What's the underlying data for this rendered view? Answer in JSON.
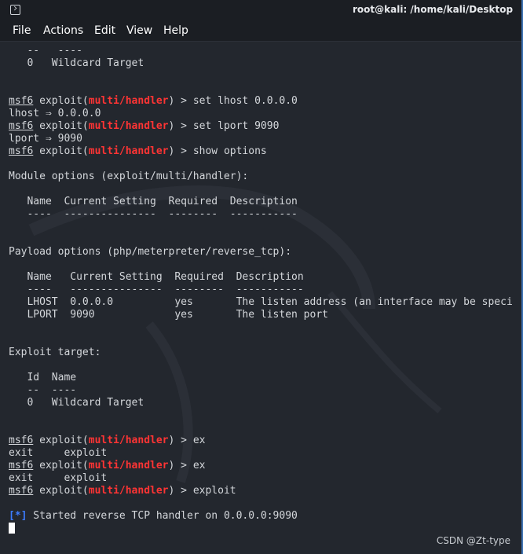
{
  "window": {
    "title": "root@kali: /home/kali/Desktop"
  },
  "menu": [
    "File",
    "Actions",
    "Edit",
    "View",
    "Help"
  ],
  "icons": {
    "app": "terminal-icon",
    "background": "kali-dragon-icon"
  },
  "colors": {
    "background": "#23272e",
    "text": "#d4d7db",
    "module": "#ff3434",
    "status": "#3c7cff"
  },
  "lines": [
    [
      {
        "t": "   --   ----"
      }
    ],
    [
      {
        "t": "   0   Wildcard Target"
      }
    ],
    [
      {
        "t": ""
      }
    ],
    [
      {
        "t": ""
      }
    ],
    [
      {
        "t": "msf6",
        "u": true
      },
      {
        "t": " exploit("
      },
      {
        "t": "multi/handler",
        "red": true
      },
      {
        "t": ") > set lhost 0.0.0.0"
      }
    ],
    [
      {
        "t": "lhost ⇒ 0.0.0.0"
      }
    ],
    [
      {
        "t": "msf6",
        "u": true
      },
      {
        "t": " exploit("
      },
      {
        "t": "multi/handler",
        "red": true
      },
      {
        "t": ") > set lport 9090"
      }
    ],
    [
      {
        "t": "lport ⇒ 9090"
      }
    ],
    [
      {
        "t": "msf6",
        "u": true
      },
      {
        "t": " exploit("
      },
      {
        "t": "multi/handler",
        "red": true
      },
      {
        "t": ") > show options"
      }
    ],
    [
      {
        "t": ""
      }
    ],
    [
      {
        "t": "Module options (exploit/multi/handler):"
      }
    ],
    [
      {
        "t": ""
      }
    ],
    [
      {
        "t": "   Name  Current Setting  Required  Description"
      }
    ],
    [
      {
        "t": "   ----  ---------------  --------  -----------"
      }
    ],
    [
      {
        "t": ""
      }
    ],
    [
      {
        "t": ""
      }
    ],
    [
      {
        "t": "Payload options (php/meterpreter/reverse_tcp):"
      }
    ],
    [
      {
        "t": ""
      }
    ],
    [
      {
        "t": "   Name   Current Setting  Required  Description"
      }
    ],
    [
      {
        "t": "   ----   ---------------  --------  -----------"
      }
    ],
    [
      {
        "t": "   LHOST  0.0.0.0          yes       The listen address (an interface may be speci"
      }
    ],
    [
      {
        "t": "   LPORT  9090             yes       The listen port"
      }
    ],
    [
      {
        "t": ""
      }
    ],
    [
      {
        "t": ""
      }
    ],
    [
      {
        "t": "Exploit target:"
      }
    ],
    [
      {
        "t": ""
      }
    ],
    [
      {
        "t": "   Id  Name"
      }
    ],
    [
      {
        "t": "   --  ----"
      }
    ],
    [
      {
        "t": "   0   Wildcard Target"
      }
    ],
    [
      {
        "t": ""
      }
    ],
    [
      {
        "t": ""
      }
    ],
    [
      {
        "t": "msf6",
        "u": true
      },
      {
        "t": " exploit("
      },
      {
        "t": "multi/handler",
        "red": true
      },
      {
        "t": ") > ex"
      }
    ],
    [
      {
        "t": "exit     exploit"
      }
    ],
    [
      {
        "t": "msf6",
        "u": true
      },
      {
        "t": " exploit("
      },
      {
        "t": "multi/handler",
        "red": true
      },
      {
        "t": ") > ex"
      }
    ],
    [
      {
        "t": "exit     exploit"
      }
    ],
    [
      {
        "t": "msf6",
        "u": true
      },
      {
        "t": " exploit("
      },
      {
        "t": "multi/handler",
        "red": true
      },
      {
        "t": ") > exploit"
      }
    ],
    [
      {
        "t": ""
      }
    ],
    [
      {
        "t": "[*]",
        "blue": true
      },
      {
        "t": " Started reverse TCP handler on 0.0.0.0:9090"
      }
    ]
  ],
  "watermark": "CSDN @Zt-type"
}
